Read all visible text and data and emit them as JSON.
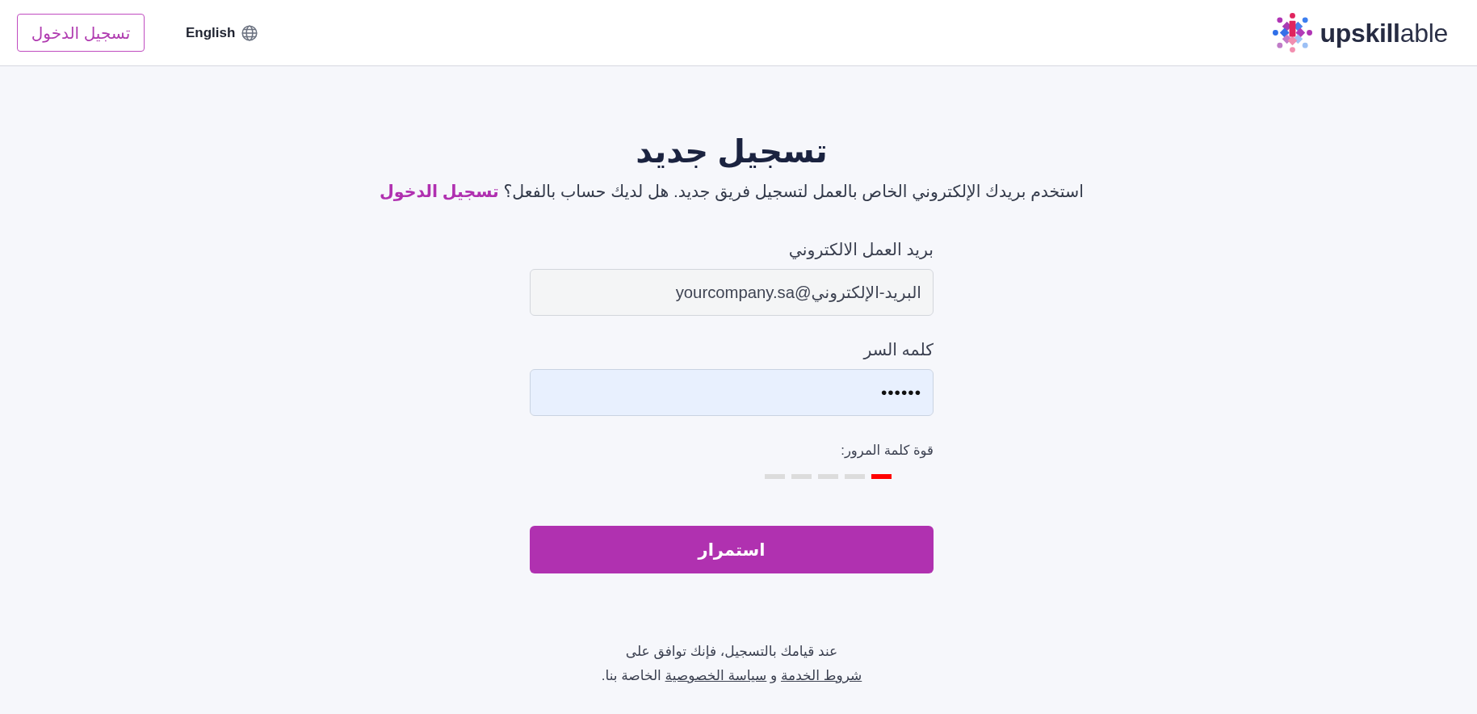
{
  "header": {
    "logo_text": "**upskill**able",
    "language": "English",
    "login_button": "تسجيل الدخول"
  },
  "title": "تسجيل جديد",
  "subtitle": {
    "text": "استخدم بريدك الإلكتروني الخاص بالعمل لتسجيل فريق جديد. هل لديك حساب بالفعل؟",
    "link": "تسجيل الدخول"
  },
  "fields": [
    {
      "kind": "email",
      "label": "بريد العمل الالكتروني",
      "placeholder": "البريد-الإلكتروني@yourcompany.sa",
      "autofilled": false
    },
    {
      "kind": "password",
      "label": "كلمه السر",
      "value": "••••••",
      "autofilled": true
    }
  ],
  "password_strength": {
    "label": "قوة كلمة المرور:",
    "level": 0.2
  },
  "continue_button": "استمرار",
  "terms": {
    "line_1": "عند قيامك بالتسجيل، فإنك توافق على",
    "terms_link": "شروط الخدمة",
    "conjunction": "و",
    "privacy_link": "سياسة الخصوصية",
    "ending": "الخاصة بنا."
  }
}
